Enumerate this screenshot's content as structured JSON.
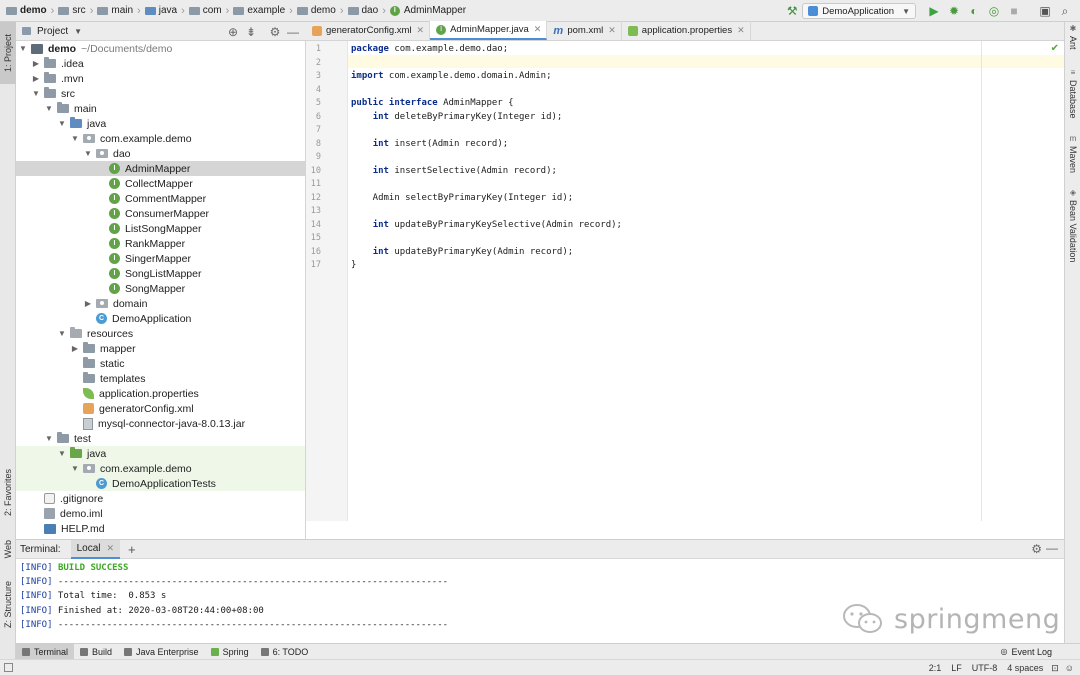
{
  "breadcrumb": [
    {
      "label": "demo",
      "icon": "module-icon",
      "bold": true
    },
    {
      "label": "src",
      "icon": "folder-icon"
    },
    {
      "label": "main",
      "icon": "folder-icon"
    },
    {
      "label": "java",
      "icon": "source-folder-icon"
    },
    {
      "label": "com",
      "icon": "folder-icon"
    },
    {
      "label": "example",
      "icon": "folder-icon"
    },
    {
      "label": "demo",
      "icon": "folder-icon"
    },
    {
      "label": "dao",
      "icon": "folder-icon"
    },
    {
      "label": "AdminMapper",
      "icon": "interface-icon"
    }
  ],
  "run_config": {
    "label": "DemoApplication"
  },
  "left_strip": {
    "project": "1: Project",
    "favorites": "2: Favorites",
    "web": "Web",
    "structure": "Z: Structure"
  },
  "right_strip": {
    "ant": "Ant",
    "database": "Database",
    "maven": "Maven",
    "bean_validation": "Bean Validation"
  },
  "project_panel": {
    "title": "Project"
  },
  "tree": [
    {
      "label": "demo",
      "extra": "~/Documents/demo",
      "depth": 0,
      "arrow": "down",
      "icon": "module",
      "bold": true
    },
    {
      "label": ".idea",
      "depth": 1,
      "arrow": "right",
      "icon": "folder"
    },
    {
      "label": ".mvn",
      "depth": 1,
      "arrow": "right",
      "icon": "folder"
    },
    {
      "label": "src",
      "depth": 1,
      "arrow": "down",
      "icon": "folder"
    },
    {
      "label": "main",
      "depth": 2,
      "arrow": "down",
      "icon": "folder"
    },
    {
      "label": "java",
      "depth": 3,
      "arrow": "down",
      "icon": "folder-blue"
    },
    {
      "label": "com.example.demo",
      "depth": 4,
      "arrow": "down",
      "icon": "package"
    },
    {
      "label": "dao",
      "depth": 5,
      "arrow": "down",
      "icon": "package"
    },
    {
      "label": "AdminMapper",
      "depth": 6,
      "arrow": "",
      "icon": "interface",
      "selected": true
    },
    {
      "label": "CollectMapper",
      "depth": 6,
      "arrow": "",
      "icon": "interface"
    },
    {
      "label": "CommentMapper",
      "depth": 6,
      "arrow": "",
      "icon": "interface"
    },
    {
      "label": "ConsumerMapper",
      "depth": 6,
      "arrow": "",
      "icon": "interface"
    },
    {
      "label": "ListSongMapper",
      "depth": 6,
      "arrow": "",
      "icon": "interface"
    },
    {
      "label": "RankMapper",
      "depth": 6,
      "arrow": "",
      "icon": "interface"
    },
    {
      "label": "SingerMapper",
      "depth": 6,
      "arrow": "",
      "icon": "interface"
    },
    {
      "label": "SongListMapper",
      "depth": 6,
      "arrow": "",
      "icon": "interface"
    },
    {
      "label": "SongMapper",
      "depth": 6,
      "arrow": "",
      "icon": "interface"
    },
    {
      "label": "domain",
      "depth": 5,
      "arrow": "right",
      "icon": "package"
    },
    {
      "label": "DemoApplication",
      "depth": 5,
      "arrow": "",
      "icon": "class"
    },
    {
      "label": "resources",
      "depth": 3,
      "arrow": "down",
      "icon": "folder-res"
    },
    {
      "label": "mapper",
      "depth": 4,
      "arrow": "right",
      "icon": "folder"
    },
    {
      "label": "static",
      "depth": 4,
      "arrow": "",
      "icon": "folder"
    },
    {
      "label": "templates",
      "depth": 4,
      "arrow": "",
      "icon": "folder"
    },
    {
      "label": "application.properties",
      "depth": 4,
      "arrow": "",
      "icon": "leaf"
    },
    {
      "label": "generatorConfig.xml",
      "depth": 4,
      "arrow": "",
      "icon": "xml"
    },
    {
      "label": "mysql-connector-java-8.0.13.jar",
      "depth": 4,
      "arrow": "",
      "icon": "jar"
    },
    {
      "label": "test",
      "depth": 2,
      "arrow": "down",
      "icon": "folder"
    },
    {
      "label": "java",
      "depth": 3,
      "arrow": "down",
      "icon": "folder-green",
      "green": true
    },
    {
      "label": "com.example.demo",
      "depth": 4,
      "arrow": "down",
      "icon": "package",
      "green": true
    },
    {
      "label": "DemoApplicationTests",
      "depth": 5,
      "arrow": "",
      "icon": "class",
      "green": true
    },
    {
      "label": ".gitignore",
      "depth": 1,
      "arrow": "",
      "icon": "git"
    },
    {
      "label": "demo.iml",
      "depth": 1,
      "arrow": "",
      "icon": "iml"
    },
    {
      "label": "HELP.md",
      "depth": 1,
      "arrow": "",
      "icon": "md"
    }
  ],
  "editor_tabs": [
    {
      "label": "generatorConfig.xml",
      "icon": "xml",
      "active": false
    },
    {
      "label": "AdminMapper.java",
      "icon": "interface",
      "active": true
    },
    {
      "label": "pom.xml",
      "icon": "maven",
      "active": false
    },
    {
      "label": "application.properties",
      "icon": "leaf",
      "active": false
    }
  ],
  "code_lines": [
    [
      {
        "t": "package",
        "k": true
      },
      {
        "t": " com.example.demo.dao;"
      }
    ],
    [],
    [
      {
        "t": "import",
        "k": true
      },
      {
        "t": " com.example.demo.domain.Admin;"
      }
    ],
    [],
    [
      {
        "t": "public interface",
        "k": true
      },
      {
        "t": " AdminMapper {"
      }
    ],
    [
      {
        "t": "    "
      },
      {
        "t": "int",
        "k": true
      },
      {
        "t": " deleteByPrimaryKey(Integer id);"
      }
    ],
    [],
    [
      {
        "t": "    "
      },
      {
        "t": "int",
        "k": true
      },
      {
        "t": " insert(Admin record);"
      }
    ],
    [],
    [
      {
        "t": "    "
      },
      {
        "t": "int",
        "k": true
      },
      {
        "t": " insertSelective(Admin record);"
      }
    ],
    [],
    [
      {
        "t": "    Admin selectByPrimaryKey(Integer id);"
      }
    ],
    [],
    [
      {
        "t": "    "
      },
      {
        "t": "int",
        "k": true
      },
      {
        "t": " updateByPrimaryKeySelective(Admin record);"
      }
    ],
    [],
    [
      {
        "t": "    "
      },
      {
        "t": "int",
        "k": true
      },
      {
        "t": " updateByPrimaryKey(Admin record);"
      }
    ],
    [
      {
        "t": "}"
      }
    ]
  ],
  "terminal": {
    "title": "Terminal:",
    "tab": "Local",
    "lines": [
      [
        {
          "t": "[INFO]",
          "c": "info"
        },
        {
          "t": " "
        },
        {
          "t": "BUILD SUCCESS",
          "c": "ok"
        }
      ],
      [
        {
          "t": "[INFO]",
          "c": "info"
        },
        {
          "t": " ------------------------------------------------------------------------"
        }
      ],
      [
        {
          "t": "[INFO]",
          "c": "info"
        },
        {
          "t": " Total time:  0.853 s"
        }
      ],
      [
        {
          "t": "[INFO]",
          "c": "info"
        },
        {
          "t": " Finished at: 2020-03-08T20:44:00+08:00"
        }
      ],
      [
        {
          "t": "[INFO]",
          "c": "info"
        },
        {
          "t": " ------------------------------------------------------------------------"
        }
      ]
    ]
  },
  "watermark": {
    "text": "springmeng"
  },
  "bottom_tools": [
    {
      "label": "Terminal",
      "active": true
    },
    {
      "label": "Build"
    },
    {
      "label": "Java Enterprise"
    },
    {
      "label": "Spring"
    },
    {
      "label": "6: TODO"
    }
  ],
  "event_log": "Event Log",
  "status": {
    "position": "2:1",
    "line_sep": "LF",
    "encoding": "UTF-8",
    "indent": "4 spaces"
  },
  "colors": {
    "keyword": "#0b2d8c",
    "success": "#3aa822",
    "info": "#1b3fa0",
    "accent": "#4d8fd6",
    "interface": "#62a34a",
    "class": "#4c9bd3"
  }
}
